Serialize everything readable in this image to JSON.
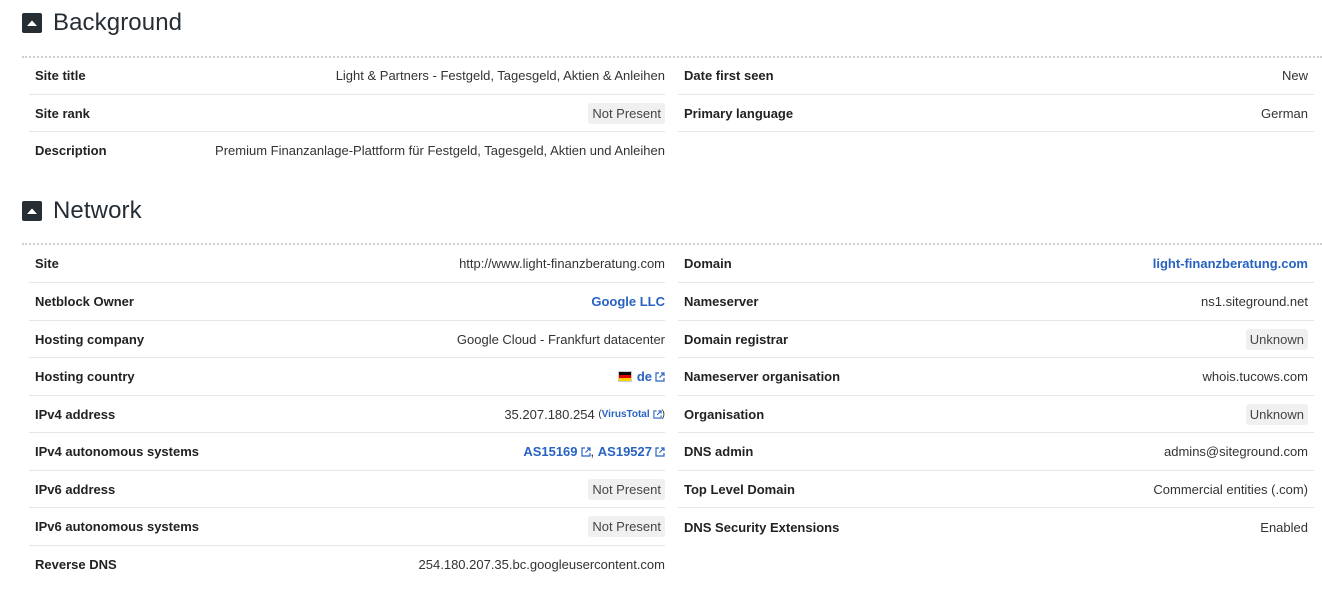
{
  "background": {
    "title": "Background",
    "left": [
      {
        "label": "Site title",
        "value": "Light & Partners - Festgeld, Tagesgeld, Aktien & Anleihen",
        "type": "text"
      },
      {
        "label": "Site rank",
        "value": "Not Present",
        "type": "badge"
      },
      {
        "label": "Description",
        "value": "Premium Finanzanlage-Plattform für Festgeld, Tagesgeld, Aktien und Anleihen",
        "type": "text"
      }
    ],
    "right": [
      {
        "label": "Date first seen",
        "value": "New",
        "type": "text"
      },
      {
        "label": "Primary language",
        "value": "German",
        "type": "text"
      }
    ]
  },
  "network": {
    "title": "Network",
    "left": {
      "site": {
        "label": "Site",
        "value": "http://www.light-finanzberatung.com"
      },
      "netblock_owner": {
        "label": "Netblock Owner",
        "value": "Google LLC"
      },
      "hosting_company": {
        "label": "Hosting company",
        "value": "Google Cloud - Frankfurt datacenter"
      },
      "hosting_country": {
        "label": "Hosting country",
        "value": "de",
        "flag_colors": [
          "#000000",
          "#dd0000",
          "#ffce00"
        ]
      },
      "ipv4_address": {
        "label": "IPv4 address",
        "value": "35.207.180.254",
        "paren_open": "(",
        "link": "VirusTotal",
        "paren_close": ")"
      },
      "ipv4_as": {
        "label": "IPv4 autonomous systems",
        "as1": "AS15169",
        "sep": ",",
        "as2": "AS19527"
      },
      "ipv6_address": {
        "label": "IPv6 address",
        "value": "Not Present"
      },
      "ipv6_as": {
        "label": "IPv6 autonomous systems",
        "value": "Not Present"
      },
      "reverse_dns": {
        "label": "Reverse DNS",
        "value": "254.180.207.35.bc.googleusercontent.com"
      }
    },
    "right": {
      "domain": {
        "label": "Domain",
        "value": "light-finanzberatung.com"
      },
      "nameserver": {
        "label": "Nameserver",
        "value": "ns1.siteground.net"
      },
      "domain_registrar": {
        "label": "Domain registrar",
        "value": "Unknown"
      },
      "nameserver_org": {
        "label": "Nameserver organisation",
        "value": "whois.tucows.com"
      },
      "organisation": {
        "label": "Organisation",
        "value": "Unknown"
      },
      "dns_admin": {
        "label": "DNS admin",
        "value": "admins@siteground.com"
      },
      "tld": {
        "label": "Top Level Domain",
        "value": "Commercial entities (.com)"
      },
      "dnssec": {
        "label": "DNS Security Extensions",
        "value": "Enabled"
      }
    }
  },
  "colors": {
    "link": "#2863c2",
    "icon_bg": "#262e35",
    "badge_bg": "#f0f0f0"
  },
  "icons": {
    "toggle": "caret-up-icon",
    "external": "external-link-icon"
  }
}
